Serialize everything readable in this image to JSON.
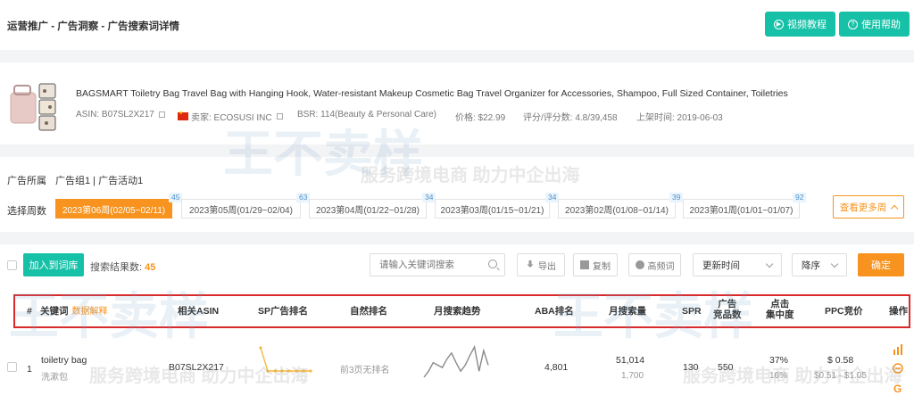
{
  "header": {
    "breadcrumb": "运营推广 - 广告洞察 - 广告搜索词详情",
    "video_tutorial": "视频教程",
    "help": "使用帮助"
  },
  "product": {
    "title": "BAGSMART Toiletry Bag Travel Bag with Hanging Hook, Water-resistant Makeup Cosmetic Bag Travel Organizer for Accessories, Shampoo, Full Sized Container, Toiletries",
    "asin": "ASIN: B07SL2X217",
    "seller": "卖家: ECOSUSI INC",
    "bsr": "BSR: 114(Beauty & Personal Care)",
    "price": "价格: $22.99",
    "rating": "评分/评分数: 4.8/39,458",
    "listed": "上架时间: 2019-06-03"
  },
  "watermark": {
    "brand": "王不卖样",
    "slogan": "服务跨境电商 助力中企出海"
  },
  "filters": {
    "ad_group_label": "广告所属",
    "ad_group_value": "广告组1 | 广告活动1",
    "week_label": "选择周数",
    "weeks": [
      {
        "label": "2023第06周(02/05~02/11)",
        "count": "45",
        "active": true
      },
      {
        "label": "2023第05周(01/29~02/04)",
        "count": "63"
      },
      {
        "label": "2023第04周(01/22~01/28)",
        "count": "34"
      },
      {
        "label": "2023第03周(01/15~01/21)",
        "count": "34"
      },
      {
        "label": "2023第02周(01/08~01/14)",
        "count": "39"
      },
      {
        "label": "2023第01周(01/01~01/07)",
        "count": "92"
      }
    ],
    "more_weeks": "查看更多周"
  },
  "toolbar": {
    "add_to_lib": "加入到词库",
    "result_label": "搜索结果数:",
    "result_count": "45",
    "search_placeholder": "请输入关键词搜索",
    "export": "导出",
    "copy": "复制",
    "high_freq": "高频词",
    "sort_field": "更新时间",
    "sort_order": "降序",
    "confirm": "确定"
  },
  "table": {
    "headers": {
      "index": "#",
      "keyword": "关键词",
      "data_explain": "数据解释",
      "asin": "相关ASIN",
      "sp_rank": "SP广告排名",
      "natural_rank": "自然排名",
      "trend": "月搜索趋势",
      "aba": "ABA排名",
      "monthly_volume": "月搜索量",
      "spr": "SPR",
      "ad_products_1": "广告",
      "ad_products_2": "竞品数",
      "click_conc_1": "点击",
      "click_conc_2": "集中度",
      "ppc": "PPC竞价",
      "action": "操作"
    },
    "rows": [
      {
        "index": "1",
        "keyword": "toiletry bag",
        "keyword_cn": "洗漱包",
        "asin": "B07SL2X217",
        "natural_rank": "前3页无排名",
        "aba": "4,801",
        "monthly_volume": "51,014",
        "monthly_volume_sub": "1,700",
        "spr": "130",
        "ad_products": "550",
        "click_conc": "37%",
        "click_conc_sub": "16%",
        "ppc": "$ 0.58",
        "ppc_range": "$0.51 - $1.05",
        "sp_trend": [
          3,
          2,
          2,
          2,
          2,
          2,
          2,
          2
        ],
        "search_trend": [
          40,
          45,
          52,
          50,
          48,
          55,
          60,
          52,
          45,
          50,
          58,
          65,
          45,
          62,
          50
        ]
      }
    ]
  },
  "colors": {
    "teal": "#16c1a7",
    "orange": "#f7931e",
    "highlight_border": "#d9292a"
  }
}
